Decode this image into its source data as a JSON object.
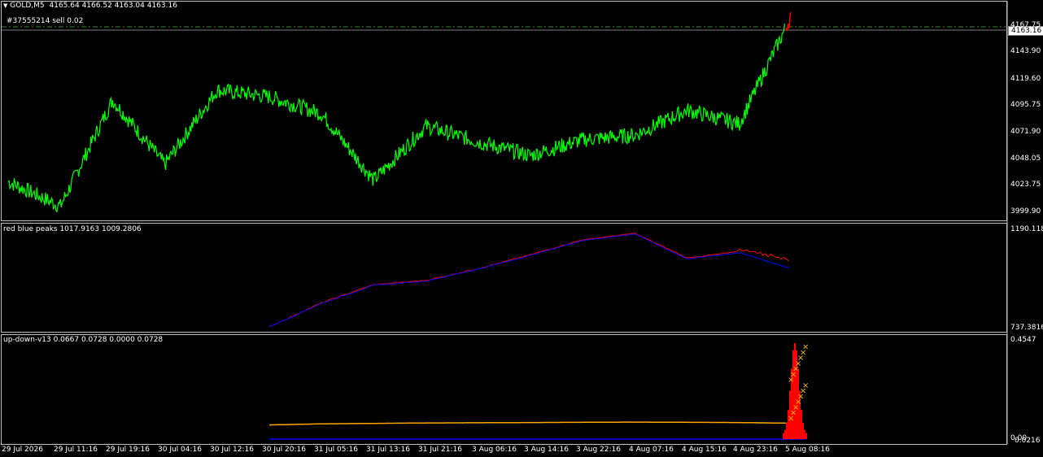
{
  "main_header": {
    "symbol": "GOLD,M5",
    "ohlc": "4165.64 4166.52 4163.04 4163.16"
  },
  "order_label": "#37555214 sell 0.02",
  "current_price": "4163.16",
  "main_yticks": [
    "4167.75",
    "4143.90",
    "4119.60",
    "4095.75",
    "4071.90",
    "4048.05",
    "4023.75",
    "3999.90"
  ],
  "ind1": {
    "header": "red blue peaks 1017.9163 1009.2806",
    "yticks": [
      "1190.1184",
      "737.3816"
    ]
  },
  "ind2": {
    "header": "up-down-v13 0.0667 0.0728 0.0000 0.0728",
    "yticks": [
      "0.4547",
      "0.00",
      "0.0216"
    ]
  },
  "xticks": [
    "29 Jul 2026",
    "29 Jul 11:16",
    "29 Jul 19:16",
    "30 Jul 04:16",
    "30 Jul 12:16",
    "30 Jul 20:16",
    "31 Jul 05:16",
    "31 Jul 13:16",
    "31 Jul 21:16",
    "3 Aug 06:16",
    "3 Aug 14:16",
    "3 Aug 22:16",
    "4 Aug 07:16",
    "4 Aug 15:16",
    "4 Aug 23:16",
    "5 Aug 08:16"
  ],
  "colors": {
    "price": "#00ff00",
    "price_recent": "#ff0000",
    "ind_red": "#ff0000",
    "ind_blue": "#0000ff",
    "orange": "#ffa500",
    "marker": "#ffc000",
    "grid": "#c0c0c0",
    "order_line": "#3c8a3c"
  },
  "chart_data": [
    {
      "type": "line",
      "title": "GOLD,M5",
      "x": [
        "29 Jul 2026",
        "29 Jul 11:16",
        "29 Jul 19:16",
        "30 Jul 04:16",
        "30 Jul 12:16",
        "30 Jul 20:16",
        "31 Jul 05:16",
        "31 Jul 13:16",
        "31 Jul 21:16",
        "3 Aug 06:16",
        "3 Aug 14:16",
        "3 Aug 22:16",
        "4 Aug 07:16",
        "4 Aug 15:16",
        "4 Aug 23:16",
        "5 Aug 08:16"
      ],
      "values": [
        4023,
        4001,
        4095,
        4038,
        4104,
        4098,
        4083,
        4024,
        4072,
        4058,
        4046,
        4060,
        4064,
        4086,
        4074,
        4170
      ],
      "ylim": [
        3995,
        4175
      ],
      "yticks": [
        4167.75,
        4143.9,
        4119.6,
        4095.75,
        4071.9,
        4048.05,
        4023.75,
        3999.9
      ]
    },
    {
      "type": "line",
      "title": "red blue peaks",
      "series": [
        {
          "name": "red",
          "values": [
            null,
            null,
            null,
            null,
            null,
            737,
            850,
            935,
            955,
            1010,
            1075,
            1145,
            1175,
            1060,
            1090,
            1040
          ]
        },
        {
          "name": "blue",
          "values": [
            null,
            null,
            null,
            null,
            null,
            737,
            848,
            932,
            952,
            1008,
            1072,
            1142,
            1172,
            1055,
            1085,
            1009
          ]
        }
      ],
      "ylim": [
        737.3816,
        1190.1184
      ]
    },
    {
      "type": "area",
      "title": "up-down-v13",
      "series": [
        {
          "name": "orange",
          "values": [
            null,
            null,
            null,
            null,
            null,
            0.065,
            0.07,
            0.072,
            0.074,
            0.075,
            0.076,
            0.077,
            0.078,
            0.077,
            0.076,
            0.0728
          ]
        },
        {
          "name": "red",
          "values": [
            0,
            0,
            0,
            0,
            0,
            0,
            0,
            0,
            0,
            0,
            0,
            0,
            0,
            0,
            0,
            0.42
          ]
        }
      ],
      "ylim": [
        0,
        0.4547
      ]
    }
  ]
}
